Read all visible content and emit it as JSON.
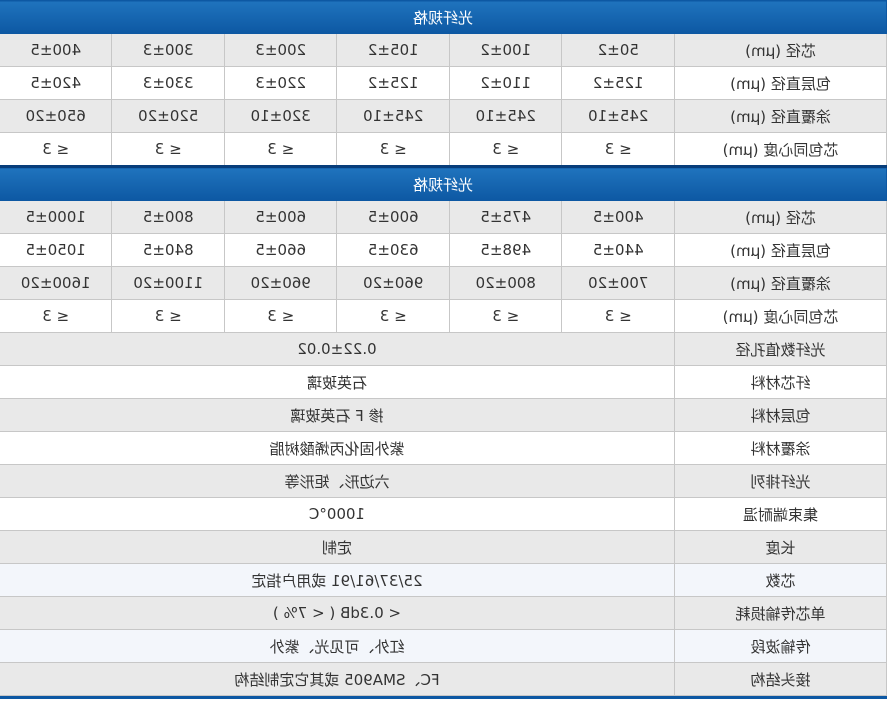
{
  "section1": {
    "header": "光纤规格",
    "rows": [
      {
        "label": "芯径 (μm)",
        "values": [
          "50±2",
          "100±2",
          "105±2",
          "200±3",
          "300±3",
          "400±5"
        ]
      },
      {
        "label": "包层直径 (μm)",
        "values": [
          "125±2",
          "110±2",
          "125±2",
          "220±3",
          "330±3",
          "420±5"
        ]
      },
      {
        "label": "涂覆直径 (μm)",
        "values": [
          "245±10",
          "245±10",
          "245±10",
          "320±10",
          "520±20",
          "650±20"
        ]
      },
      {
        "label": "芯包同心度 (μm)",
        "values": [
          "≤ 3",
          "≤ 3",
          "≤ 3",
          "≤ 3",
          "≤ 3",
          "≤ 3"
        ]
      }
    ]
  },
  "section2": {
    "header": "光纤规格",
    "rows": [
      {
        "label": "芯径 (μm)",
        "values": [
          "400±5",
          "475±5",
          "600±5",
          "600±5",
          "800±5",
          "1000±5"
        ]
      },
      {
        "label": "包层直径 (μm)",
        "values": [
          "440±5",
          "498±5",
          "630±5",
          "660±5",
          "840±5",
          "1050±5"
        ]
      },
      {
        "label": "涂覆直径 (μm)",
        "values": [
          "700±20",
          "800±20",
          "960±20",
          "960±20",
          "1100±20",
          "1600±20"
        ]
      },
      {
        "label": "芯包同心度 (μm)",
        "values": [
          "≤ 3",
          "≤ 3",
          "≤ 3",
          "≤ 3",
          "≤ 3",
          "≤ 3"
        ]
      }
    ]
  },
  "properties": [
    {
      "label": "光纤数值孔径",
      "value": "0.22±0.02"
    },
    {
      "label": "纤芯材料",
      "value": "石英玻璃"
    },
    {
      "label": "包层材料",
      "value": "掺 F 石英玻璃"
    },
    {
      "label": "涂覆材料",
      "value": "紫外固化丙烯酸树脂"
    },
    {
      "label": "光纤排列",
      "value": "六边形、矩形等"
    },
    {
      "label": "集束端耐温",
      "value": "1000°C"
    },
    {
      "label": "长度",
      "value": "定制"
    },
    {
      "label": "芯数",
      "value": "25/37/61/91 或用户指定"
    },
    {
      "label": "单芯传输损耗",
      "value": "< 0.3dB ( < 7% )"
    },
    {
      "label": "传输波段",
      "value": "红外、可见光、紫外"
    },
    {
      "label": "接头结构",
      "value": "FC、SMA905 或其它定制结构"
    }
  ],
  "colors": {
    "header": "#0d58a3",
    "grey_row": "#e9e9e9",
    "border": "#c7c7c7"
  }
}
